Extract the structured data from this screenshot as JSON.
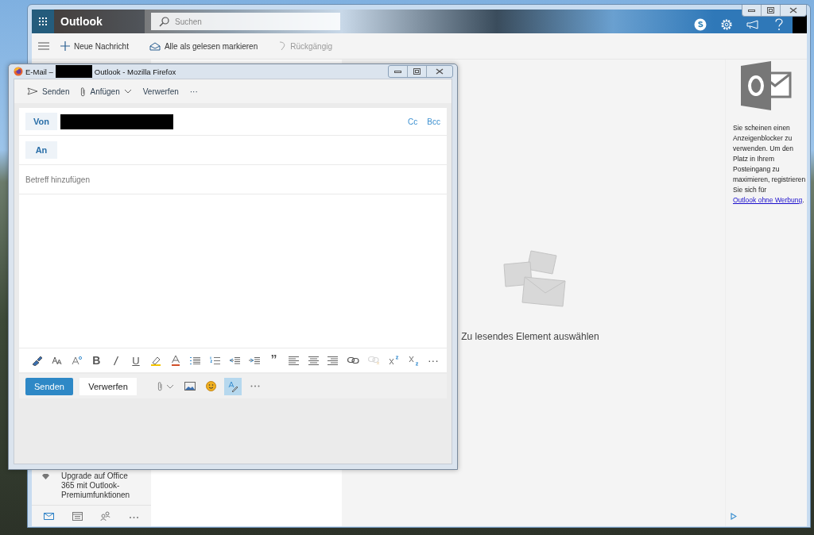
{
  "browser_window": {
    "app_name": "Outlook",
    "search": {
      "placeholder": "Suchen"
    },
    "header_icons": [
      {
        "kind": "skype"
      },
      {
        "kind": "settings"
      },
      {
        "kind": "megaphone"
      },
      {
        "kind": "help"
      }
    ],
    "commands": [
      {
        "kind": "new",
        "label": "Neue Nachricht",
        "disabled": false
      },
      {
        "kind": "read",
        "label": "Alle als gelesen markieren",
        "disabled": false
      },
      {
        "kind": "undo",
        "label": "Rückgängig",
        "disabled": true
      }
    ],
    "upgrade": {
      "label": "Upgrade auf Office 365 mit Outlook-Premiumfunktionen"
    },
    "nav": [
      {
        "kind": "mail",
        "selected": true
      },
      {
        "kind": "calendar",
        "selected": false
      },
      {
        "kind": "people",
        "selected": false
      },
      {
        "kind": "more",
        "selected": false
      }
    ],
    "reading_pane": {
      "empty_text": "Zu lesendes Element auswählen"
    },
    "ad": {
      "text": "Sie scheinen einen Anzeigenblocker zu verwenden. Um den Platz in Ihrem Posteingang zu maximieren, registrieren Sie sich für ",
      "link": "Outlook ohne Werbung",
      "text_after": "."
    }
  },
  "compose_window": {
    "title_prefix": "E-Mail –",
    "title_suffix": "Outlook - Mozilla Firefox",
    "toolbar": [
      {
        "kind": "send",
        "label": "Senden"
      },
      {
        "kind": "attach",
        "label": "Anfügen"
      },
      {
        "kind": "discard",
        "label": "Verwerfen"
      },
      {
        "kind": "more",
        "label": "···"
      }
    ],
    "from_label": "Von",
    "cc": "Cc",
    "bcc": "Bcc",
    "to_label": "An",
    "subject_placeholder": "Betreff hinzufügen",
    "format_tools": [
      {
        "kind": "painter",
        "disabled": false
      },
      {
        "kind": "font-size",
        "disabled": false
      },
      {
        "kind": "grow",
        "disabled": false
      },
      {
        "kind": "bold",
        "glyph": "B",
        "disabled": false
      },
      {
        "kind": "italic",
        "disabled": false
      },
      {
        "kind": "underline",
        "glyph": "U",
        "disabled": false
      },
      {
        "kind": "highlight",
        "disabled": false
      },
      {
        "kind": "font-color",
        "disabled": false
      },
      {
        "kind": "bullets",
        "disabled": false
      },
      {
        "kind": "numbering",
        "disabled": false
      },
      {
        "kind": "outdent",
        "disabled": false
      },
      {
        "kind": "indent",
        "disabled": false
      },
      {
        "kind": "quote",
        "glyph": "”",
        "disabled": false
      },
      {
        "kind": "align-left",
        "disabled": false
      },
      {
        "kind": "align-center",
        "disabled": false
      },
      {
        "kind": "align-right",
        "disabled": false
      },
      {
        "kind": "link",
        "disabled": false
      },
      {
        "kind": "unlink",
        "disabled": true
      },
      {
        "kind": "superscript",
        "disabled": false
      },
      {
        "kind": "subscript",
        "disabled": false
      },
      {
        "kind": "more",
        "glyph": "···",
        "disabled": false
      }
    ],
    "send_button": "Senden",
    "discard_button": "Verwerfen",
    "footer_tools": [
      {
        "kind": "attach",
        "selected": false
      },
      {
        "kind": "image",
        "selected": false
      },
      {
        "kind": "emoji",
        "selected": false
      },
      {
        "kind": "signature",
        "selected": true
      },
      {
        "kind": "more",
        "selected": false
      }
    ]
  }
}
